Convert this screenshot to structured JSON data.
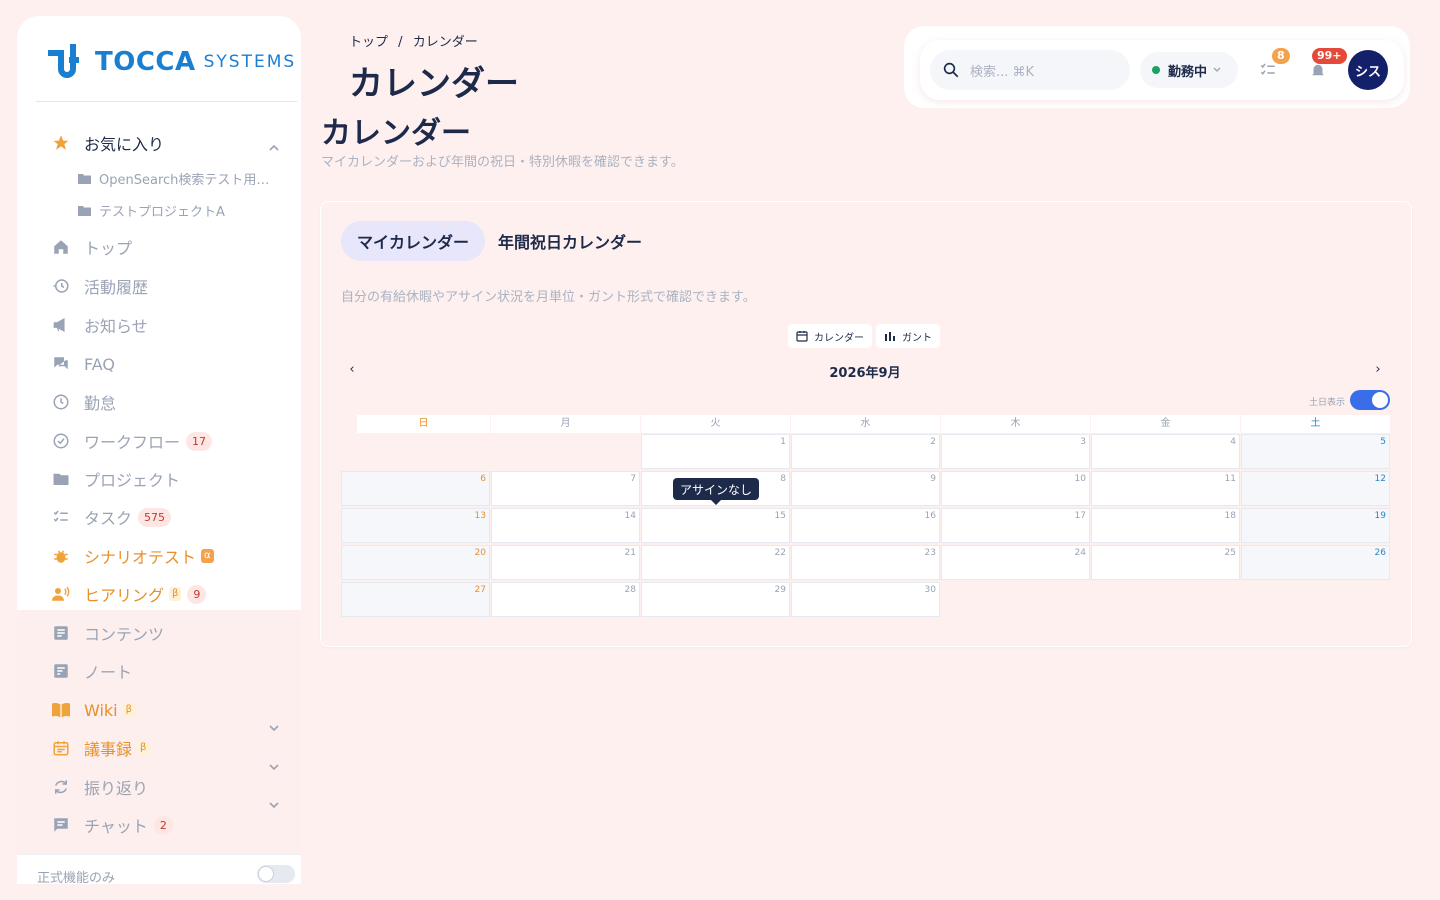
{
  "logo": {
    "brand": "TOCCA",
    "sub": "SYSTEMS"
  },
  "sidebar": {
    "favorites": {
      "label": "お気に入り",
      "icon": "star-icon",
      "items": [
        "OpenSearch検索テスト用プ...",
        "テストプロジェクトA"
      ]
    },
    "items": [
      {
        "label": "トップ",
        "icon": "home-icon"
      },
      {
        "label": "活動履歴",
        "icon": "history-icon"
      },
      {
        "label": "お知らせ",
        "icon": "megaphone-icon"
      },
      {
        "label": "FAQ",
        "icon": "faq-icon"
      },
      {
        "label": "勤怠",
        "icon": "clock-icon"
      },
      {
        "label": "ワークフロー",
        "icon": "check-circle-icon",
        "badge": "17"
      },
      {
        "label": "プロジェクト",
        "icon": "folder-icon"
      },
      {
        "label": "タスク",
        "icon": "checklist-icon",
        "badge": "575"
      },
      {
        "label": "シナリオテスト",
        "icon": "bug-icon",
        "tag": "α"
      },
      {
        "label": "ヒアリング",
        "icon": "people-voice-icon",
        "tag": "β",
        "badge": "9"
      },
      {
        "label": "コンテンツ",
        "icon": "article-icon"
      },
      {
        "label": "ノート",
        "icon": "note-icon"
      },
      {
        "label": "Wiki",
        "icon": "book-icon",
        "tag": "β"
      },
      {
        "label": "議事録",
        "icon": "calendar-note-icon",
        "tag": "β"
      },
      {
        "label": "振り返り",
        "icon": "refresh-icon"
      },
      {
        "label": "チャット",
        "icon": "chat-icon",
        "badge": "2"
      }
    ],
    "footer": {
      "label": "正式機能のみ"
    }
  },
  "header": {
    "breadcrumb": [
      "トップ",
      "/",
      "カレンダー"
    ],
    "title": "カレンダー"
  },
  "page": {
    "title": "カレンダー",
    "subtitle": "マイカレンダーおよび年間の祝日・特別休暇を確認できます。"
  },
  "topbar": {
    "search_placeholder": "検索... ⌘K",
    "status": "勤務中",
    "tasks_badge": "8",
    "notifications_badge": "99+",
    "avatar": "シス"
  },
  "tabs": [
    "マイカレンダー",
    "年間祝日カレンダー"
  ],
  "calendar": {
    "description": "自分の有給休暇やアサイン状況を月単位・ガント形式で確認できます。",
    "views": [
      "カレンダー",
      "ガント"
    ],
    "prev": "‹",
    "next": "›",
    "month": "2026年9月",
    "weekend_label": "土日表示",
    "weekdays": [
      "日",
      "月",
      "火",
      "水",
      "木",
      "金",
      "土"
    ],
    "tooltip": "アサインなし",
    "first_weekday_index": 2,
    "days_in_month": 30,
    "colors": {
      "sunday": "#e8902a",
      "saturday": "#2a86c8",
      "weekday": "#9aa3b5"
    }
  }
}
